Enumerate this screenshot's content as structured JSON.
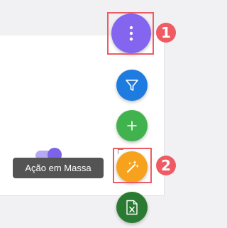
{
  "tooltip": {
    "text": "Ação em Massa"
  },
  "fab_menu": {
    "main_icon": "more-vertical-icon",
    "actions": [
      {
        "icon": "filter-icon",
        "color": "#1e7be0"
      },
      {
        "icon": "plus-icon",
        "color": "#40b34e"
      },
      {
        "icon": "magic-wand-icon",
        "color": "#f7a21c"
      },
      {
        "icon": "excel-export-icon",
        "color": "#2a7a31"
      }
    ]
  },
  "annotations": {
    "step_1": "1",
    "step_2": "2"
  },
  "colors": {
    "main_fab": "#8365ef",
    "highlight": "#ef5b63",
    "toggle": "#7c63ea"
  }
}
